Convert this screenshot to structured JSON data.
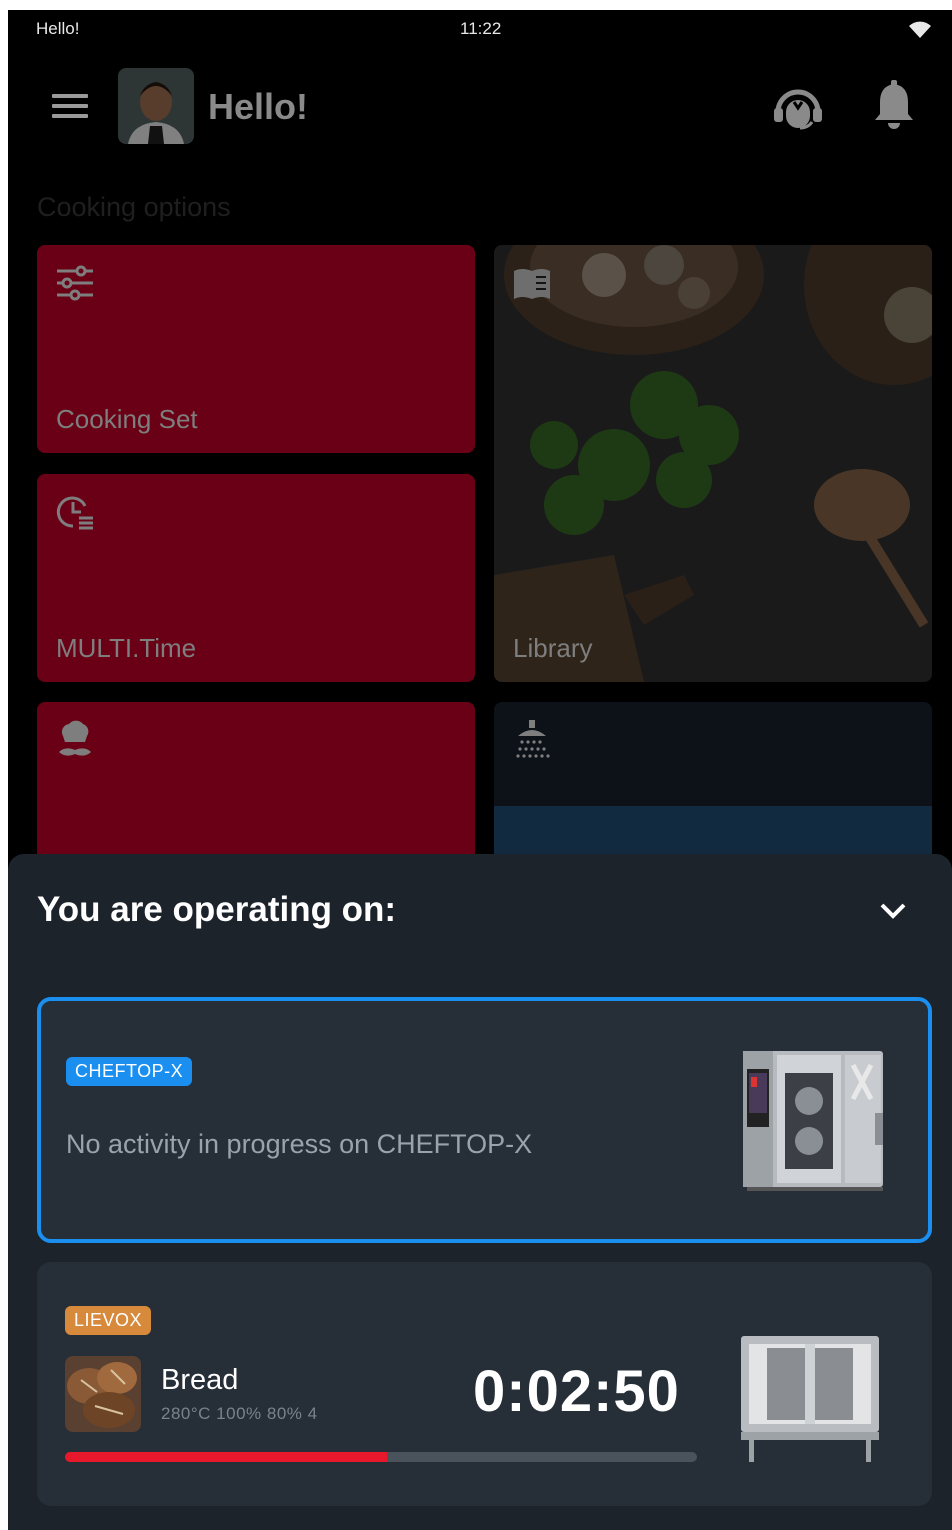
{
  "status_bar": {
    "left_text": "Hello!",
    "time": "11:22"
  },
  "header": {
    "title": "Hello!"
  },
  "cooking_options": {
    "section_label": "Cooking options",
    "tiles": [
      {
        "label": "Cooking Set",
        "icon": "sliders-icon"
      },
      {
        "label": "MULTI.Time",
        "icon": "clock-list-icon"
      },
      {
        "label": "Library",
        "icon": "book-icon"
      },
      {
        "label": "",
        "icon": "chef-icon"
      },
      {
        "label": "",
        "icon": "shower-icon"
      }
    ]
  },
  "operating_sheet": {
    "title": "You are operating on:",
    "devices": [
      {
        "badge": "CHEFTOP-X",
        "status_text": "No activity in progress on CHEFTOP-X",
        "selected": true
      },
      {
        "badge": "LIEVOX",
        "program": {
          "name": "Bread",
          "meta": "280°C  100%  80%  4"
        },
        "timer": "0:02:50",
        "progress": 0.51
      }
    ]
  },
  "colors": {
    "accent_blue": "#1b8ff0",
    "progress_red": "#e8182c",
    "tile_red": "#6a0015",
    "badge_orange": "#d7893c"
  }
}
